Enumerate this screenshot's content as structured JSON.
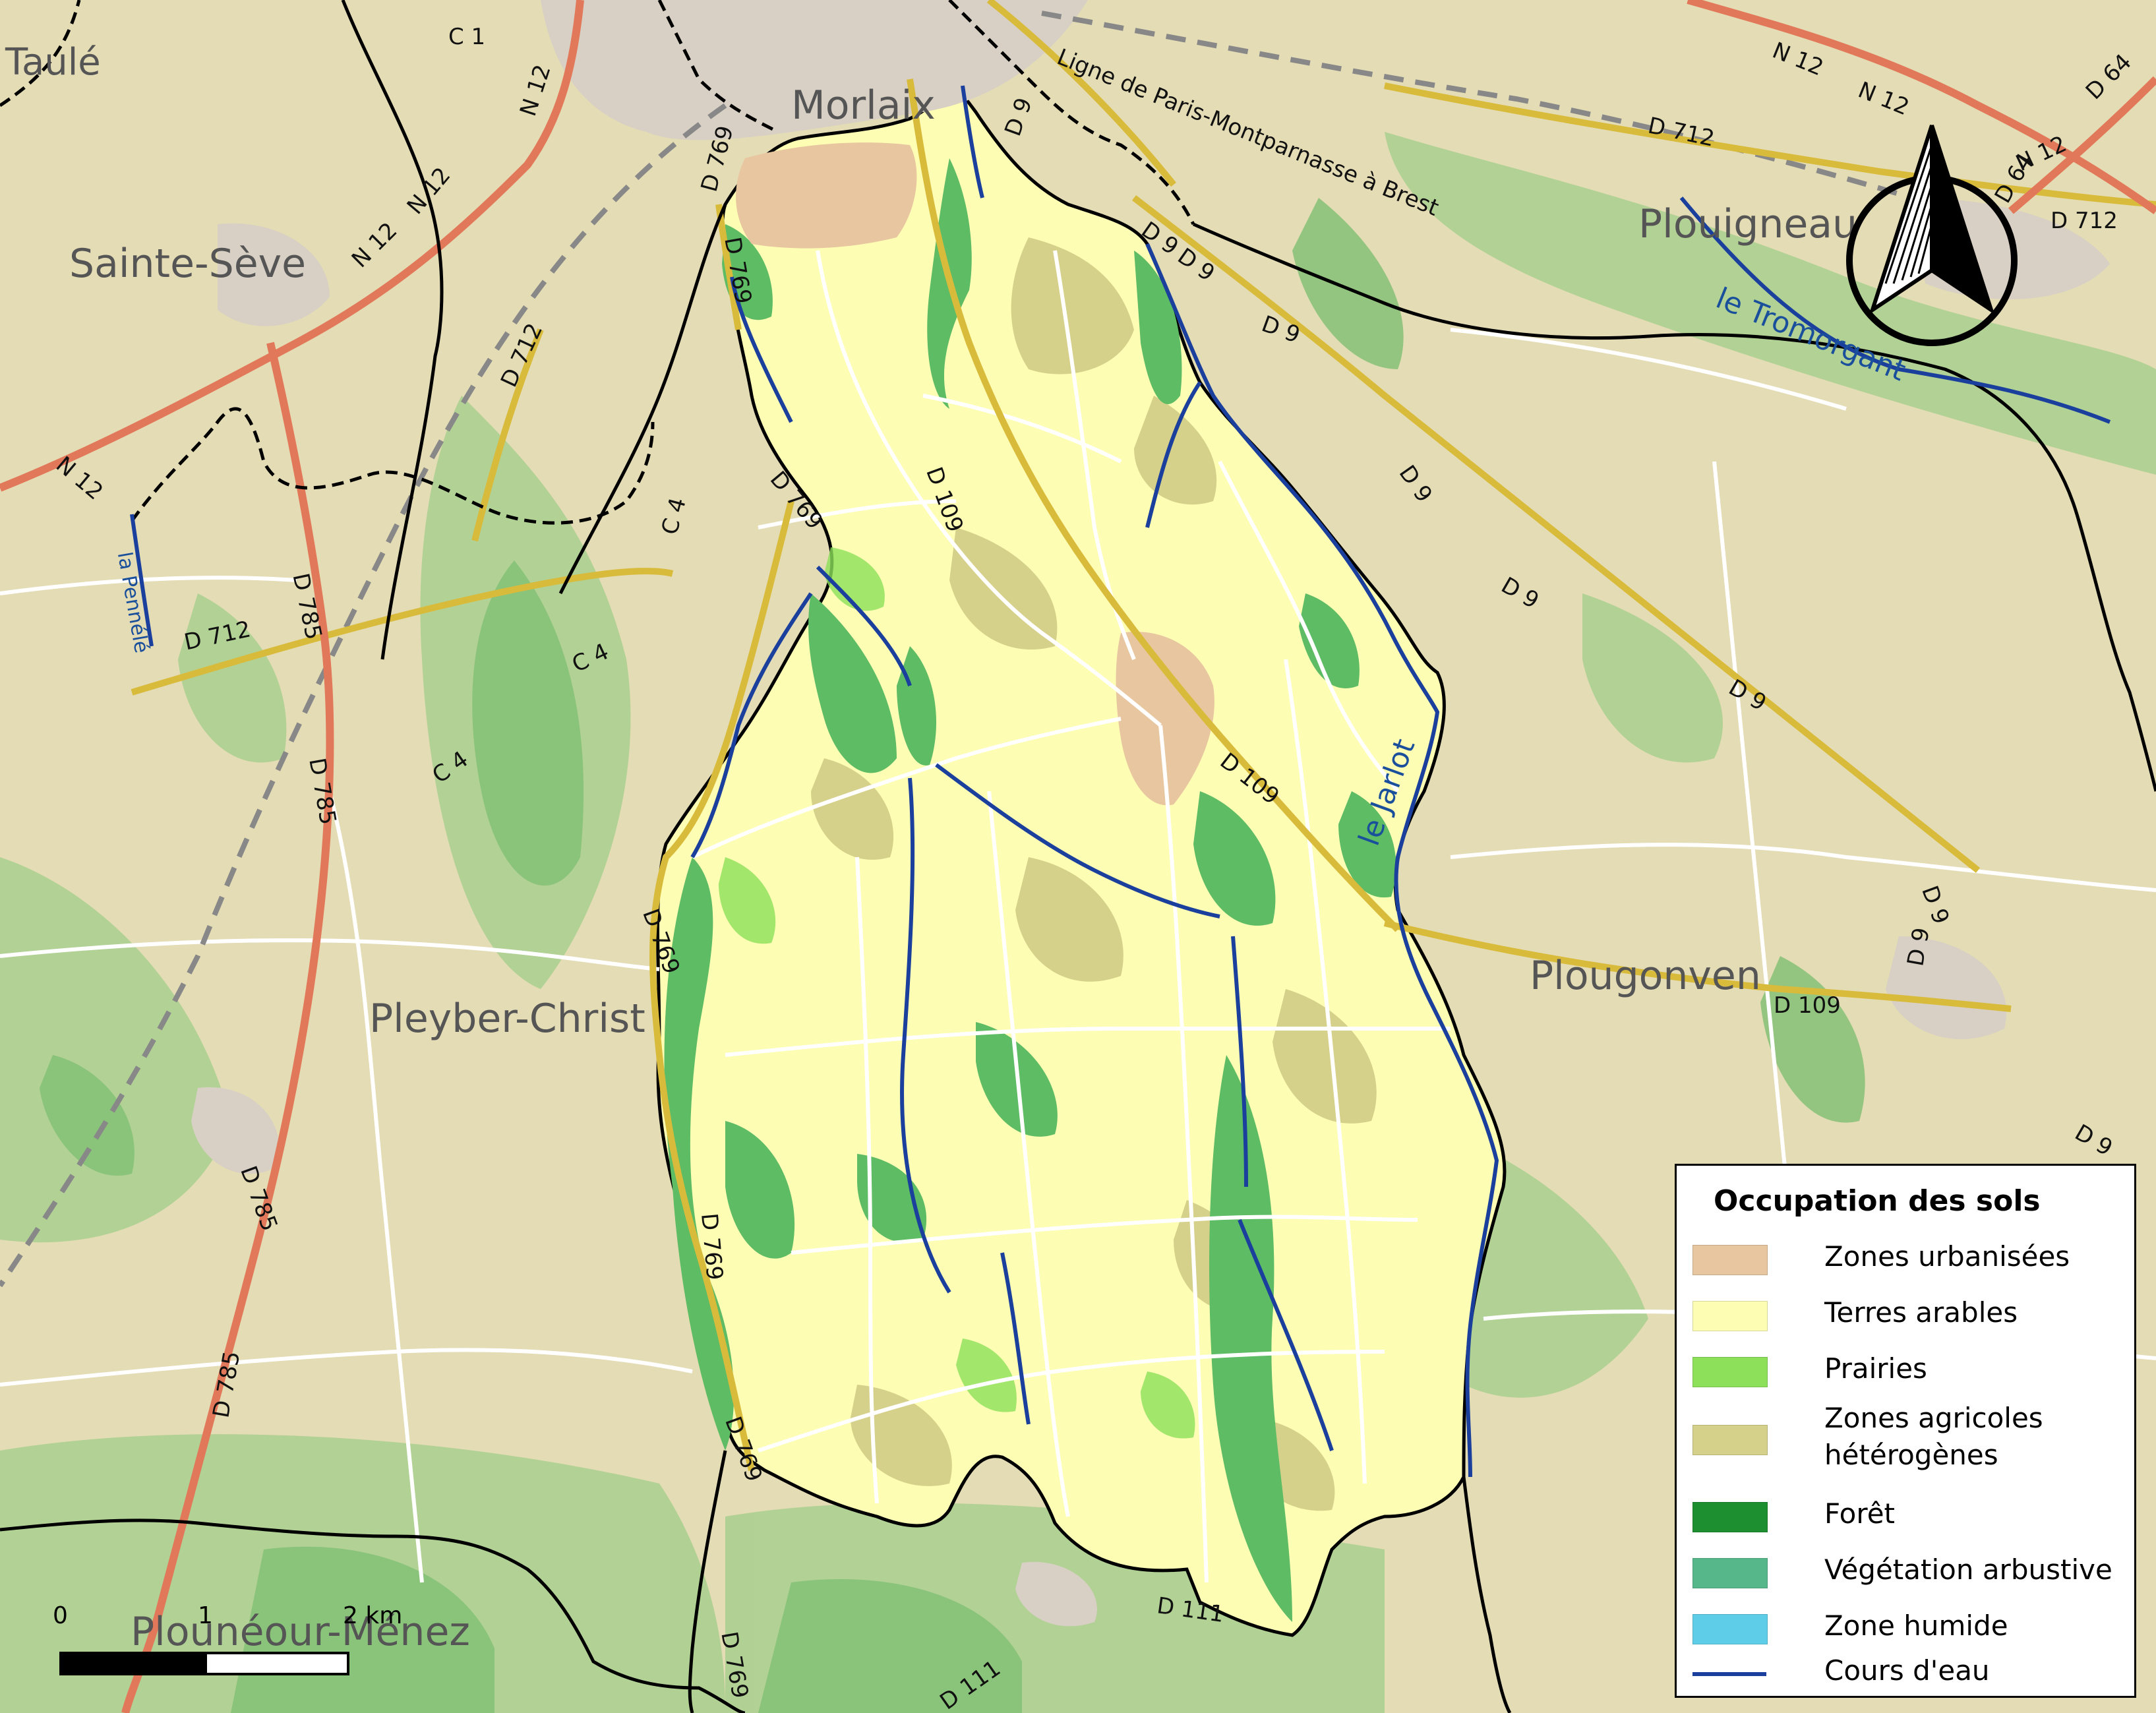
{
  "colors": {
    "background": "#e4dcb4",
    "urban": "#e8c6a0",
    "arable": "#fefdb4",
    "prairie": "#8ce05a",
    "heterogeneous": "#d6d18a",
    "forest": "#1e8f30",
    "forest_fill": "#5ebc64",
    "shrub": "#56b88a",
    "wetland": "#5ecde8",
    "river": "#1a3f9c",
    "national_road": "#e2785a",
    "department_road": "#e6cc54",
    "minor_road": "#ffffff"
  },
  "places": {
    "taule": "Taulé",
    "morlaix": "Morlaix",
    "sainte_seve": "Sainte-Sève",
    "plouigneau": "Plouigneau",
    "pleyber_christ": "Pleyber-Christ",
    "plougonven": "Plougonven",
    "ploneour_menez": "Plounéour-Ménez"
  },
  "roads": {
    "c1": "C 1",
    "n12": "N 12",
    "d9": "D 9",
    "d64": "D 64",
    "d109": "D 109",
    "d111": "D 111",
    "d712": "D 712",
    "d769": "D 769",
    "d785": "D 785",
    "c4": "C 4",
    "railway": "Ligne de Paris-Montparnasse à Brest"
  },
  "rivers": {
    "jarlot": "le Jarlot",
    "tromorgant": "le Tromorgant",
    "pennele": "la Pennélé"
  },
  "legend": {
    "title": "Occupation des sols",
    "items": [
      {
        "label": "Zones urbanisées",
        "color": "#e8c6a0",
        "kind": "fill"
      },
      {
        "label": "Terres arables",
        "color": "#fefdb4",
        "kind": "fill"
      },
      {
        "label": "Prairies",
        "color": "#8ce05a",
        "kind": "fill"
      },
      {
        "label": "Zones agricoles hétérogènes",
        "color": "#d6d18a",
        "kind": "fill"
      },
      {
        "label": "Forêt",
        "color": "#1e8f30",
        "kind": "fill"
      },
      {
        "label": "Végétation arbustive",
        "color": "#56b88a",
        "kind": "fill"
      },
      {
        "label": "Zone humide",
        "color": "#5ecde8",
        "kind": "fill"
      },
      {
        "label": "Cours d'eau",
        "color": "#1a3f9c",
        "kind": "line"
      }
    ]
  },
  "scale": {
    "zero": "0",
    "one": "1",
    "two": "2 km"
  }
}
